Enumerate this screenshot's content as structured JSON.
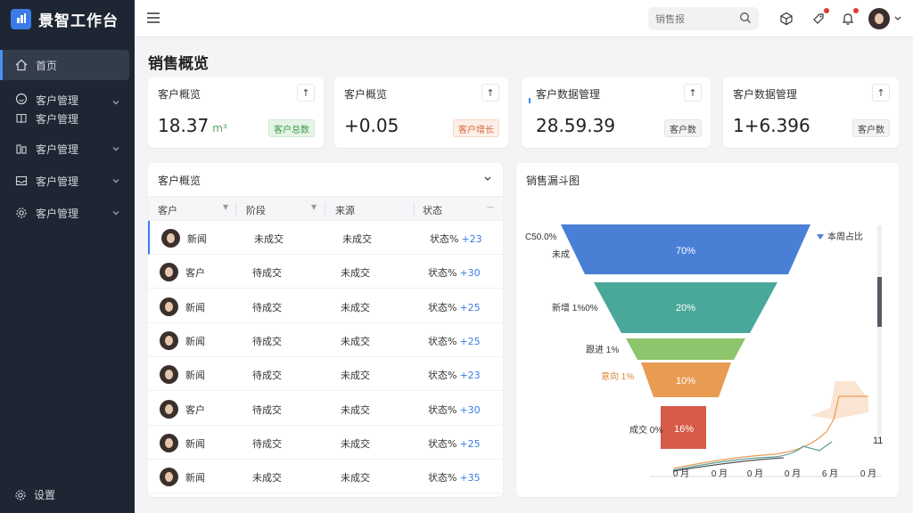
{
  "app": {
    "title": "景智工作台"
  },
  "sidebar": {
    "items": [
      {
        "label": "首页",
        "icon": "home-icon",
        "active": true
      },
      {
        "label": "客户管理",
        "label2": "客户管理",
        "icon": "smile-icon",
        "icon2": "book-icon"
      },
      {
        "label": "客户管理",
        "icon": "people-icon"
      },
      {
        "label": "客户管理",
        "icon": "inbox-icon"
      },
      {
        "label": "客户管理",
        "icon": "gear-icon"
      }
    ],
    "footer": "设置"
  },
  "topbar": {
    "search_placeholder": "销售报"
  },
  "page_title": "销售概览",
  "stats": [
    {
      "label": "客户概览",
      "value": "18.37",
      "unit": "m³",
      "badge": "客户总数",
      "badge_color": "green"
    },
    {
      "label": "客户概览",
      "value": "+0.05",
      "badge": "客户增长",
      "badge_color": "orange"
    },
    {
      "label": "客户数据管理",
      "value": "28.59.39",
      "badge": "客户数",
      "badge_color": "gray"
    },
    {
      "label": "客户数据管理",
      "value": "1+6.396",
      "badge": "客户数",
      "badge_color": "gray"
    }
  ],
  "table": {
    "title": "客户概览",
    "columns": [
      "客户",
      "阶段",
      "来源",
      "状态"
    ],
    "rows": [
      {
        "name": "新闻",
        "stage": "未成交",
        "source": "未成交",
        "status": "状态%",
        "change": "+23"
      },
      {
        "name": "客户",
        "stage": "待成交",
        "source": "未成交",
        "status": "状态%",
        "change": "+30"
      },
      {
        "name": "新闻",
        "stage": "待成交",
        "source": "未成交",
        "status": "状态%",
        "change": "+25"
      },
      {
        "name": "新闻",
        "stage": "待成交",
        "source": "未成交",
        "status": "状态%",
        "change": "+25"
      },
      {
        "name": "新闻",
        "stage": "待成交",
        "source": "未成交",
        "status": "状态%",
        "change": "+23"
      },
      {
        "name": "客户",
        "stage": "待成交",
        "source": "未成交",
        "status": "状态%",
        "change": "+30"
      },
      {
        "name": "新闻",
        "stage": "待成交",
        "source": "未成交",
        "status": "状态%",
        "change": "+25"
      },
      {
        "name": "新闻",
        "stage": "未成交",
        "source": "未成交",
        "status": "状态%",
        "change": "+35"
      }
    ]
  },
  "funnel": {
    "title": "销售漏斗图",
    "legend": "本周占比",
    "stages": [
      {
        "label": "C50.0%",
        "label2": "未成",
        "percent": "70%",
        "color": "#4a7fd6"
      },
      {
        "label": "新增 1%0%",
        "percent": "20%",
        "color": "#49a89a"
      },
      {
        "label": "跟进 1%",
        "percent": "",
        "color": "#8cc56b"
      },
      {
        "label": "意向 1%",
        "percent": "10%",
        "color": "#e89c53"
      },
      {
        "label": "成交 0%",
        "percent": "16%",
        "color": "#d85a48"
      }
    ],
    "x_ticks": [
      "0 月",
      "0 月",
      "0 月",
      "0 月",
      "6 月",
      "0 月"
    ],
    "side_value": "11"
  },
  "colors": {
    "accent": "#3b7be8",
    "sidebar": "#1f2633"
  }
}
